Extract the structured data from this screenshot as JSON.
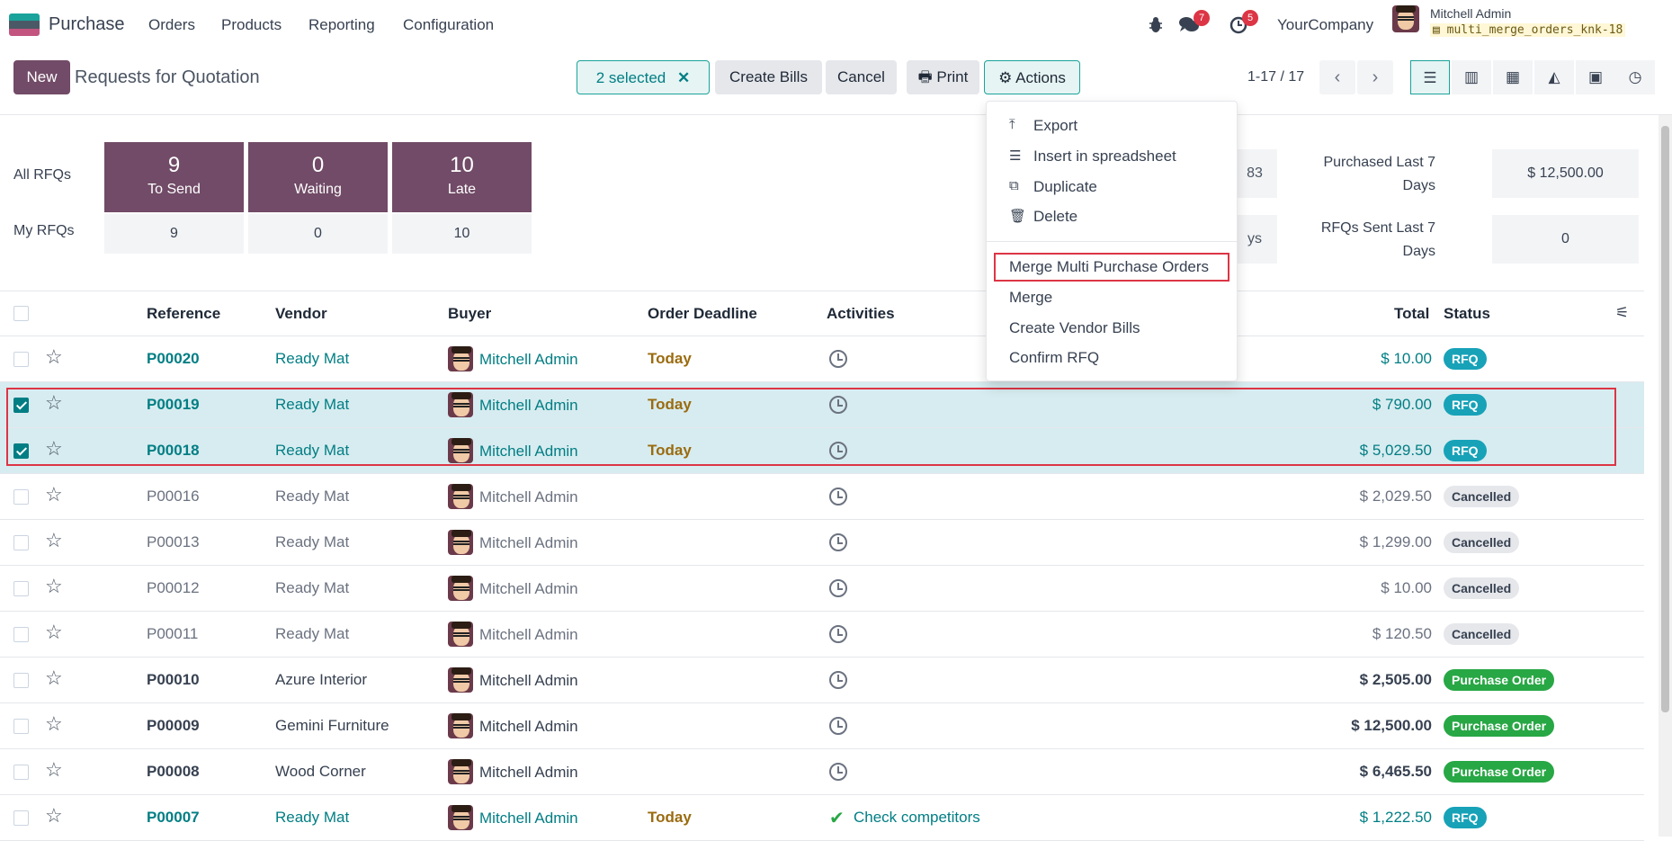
{
  "app": {
    "name": "Purchase"
  },
  "menu": [
    "Orders",
    "Products",
    "Reporting",
    "Configuration"
  ],
  "systray": {
    "messages_count": "7",
    "activities_count": "5",
    "company": "YourCompany",
    "user": "Mitchell Admin",
    "database": "multi_merge_orders_knk-18"
  },
  "control": {
    "new_label": "New",
    "title": "Requests for Quotation",
    "selected_label": "2 selected",
    "create_bills_label": "Create Bills",
    "cancel_label": "Cancel",
    "print_label": "Print",
    "actions_label": "Actions",
    "pager": "1-17 / 17"
  },
  "dashboard": {
    "all_rfqs_label": "All RFQs",
    "my_rfqs_label": "My RFQs",
    "tiles": [
      {
        "count": "9",
        "label": "To Send",
        "mine": "9"
      },
      {
        "count": "0",
        "label": "Waiting",
        "mine": "0"
      },
      {
        "count": "10",
        "label": "Late",
        "mine": "10"
      }
    ],
    "hidden_val_1": "83",
    "hidden_val_2": "ys",
    "purchased_label_1": "Purchased Last 7",
    "purchased_label_2": "Days",
    "purchased_value": "$ 12,500.00",
    "rfqs_sent_label_1": "RFQs Sent Last 7",
    "rfqs_sent_label_2": "Days",
    "rfqs_sent_value": "0"
  },
  "actions_menu": {
    "items": [
      "Export",
      "Insert in spreadsheet",
      "Duplicate",
      "Delete"
    ],
    "items2": [
      "Merge Multi Purchase Orders",
      "Merge",
      "Create Vendor Bills",
      "Confirm RFQ"
    ]
  },
  "table": {
    "headers": [
      "Reference",
      "Vendor",
      "Buyer",
      "Order Deadline",
      "Activities",
      "Total",
      "Status"
    ],
    "rows": [
      {
        "ref": "P00020",
        "vendor": "Ready Mat",
        "buyer": "Mitchell Admin",
        "deadline": "Today",
        "activity": "",
        "total": "$ 10.00",
        "status": "RFQ"
      },
      {
        "ref": "P00019",
        "vendor": "Ready Mat",
        "buyer": "Mitchell Admin",
        "deadline": "Today",
        "activity": "",
        "total": "$ 790.00",
        "status": "RFQ"
      },
      {
        "ref": "P00018",
        "vendor": "Ready Mat",
        "buyer": "Mitchell Admin",
        "deadline": "Today",
        "activity": "",
        "total": "$ 5,029.50",
        "status": "RFQ"
      },
      {
        "ref": "P00016",
        "vendor": "Ready Mat",
        "buyer": "Mitchell Admin",
        "deadline": "",
        "activity": "",
        "total": "$ 2,029.50",
        "status": "Cancelled"
      },
      {
        "ref": "P00013",
        "vendor": "Ready Mat",
        "buyer": "Mitchell Admin",
        "deadline": "",
        "activity": "",
        "total": "$ 1,299.00",
        "status": "Cancelled"
      },
      {
        "ref": "P00012",
        "vendor": "Ready Mat",
        "buyer": "Mitchell Admin",
        "deadline": "",
        "activity": "",
        "total": "$ 10.00",
        "status": "Cancelled"
      },
      {
        "ref": "P00011",
        "vendor": "Ready Mat",
        "buyer": "Mitchell Admin",
        "deadline": "",
        "activity": "",
        "total": "$ 120.50",
        "status": "Cancelled"
      },
      {
        "ref": "P00010",
        "vendor": "Azure Interior",
        "buyer": "Mitchell Admin",
        "deadline": "",
        "activity": "",
        "total": "$ 2,505.00",
        "status": "Purchase Order"
      },
      {
        "ref": "P00009",
        "vendor": "Gemini Furniture",
        "buyer": "Mitchell Admin",
        "deadline": "",
        "activity": "",
        "total": "$ 12,500.00",
        "status": "Purchase Order"
      },
      {
        "ref": "P00008",
        "vendor": "Wood Corner",
        "buyer": "Mitchell Admin",
        "deadline": "",
        "activity": "",
        "total": "$ 6,465.50",
        "status": "Purchase Order"
      },
      {
        "ref": "P00007",
        "vendor": "Ready Mat",
        "buyer": "Mitchell Admin",
        "deadline": "Today",
        "activity": "Check competitors",
        "total": "$ 1,222.50",
        "status": "RFQ"
      }
    ]
  }
}
